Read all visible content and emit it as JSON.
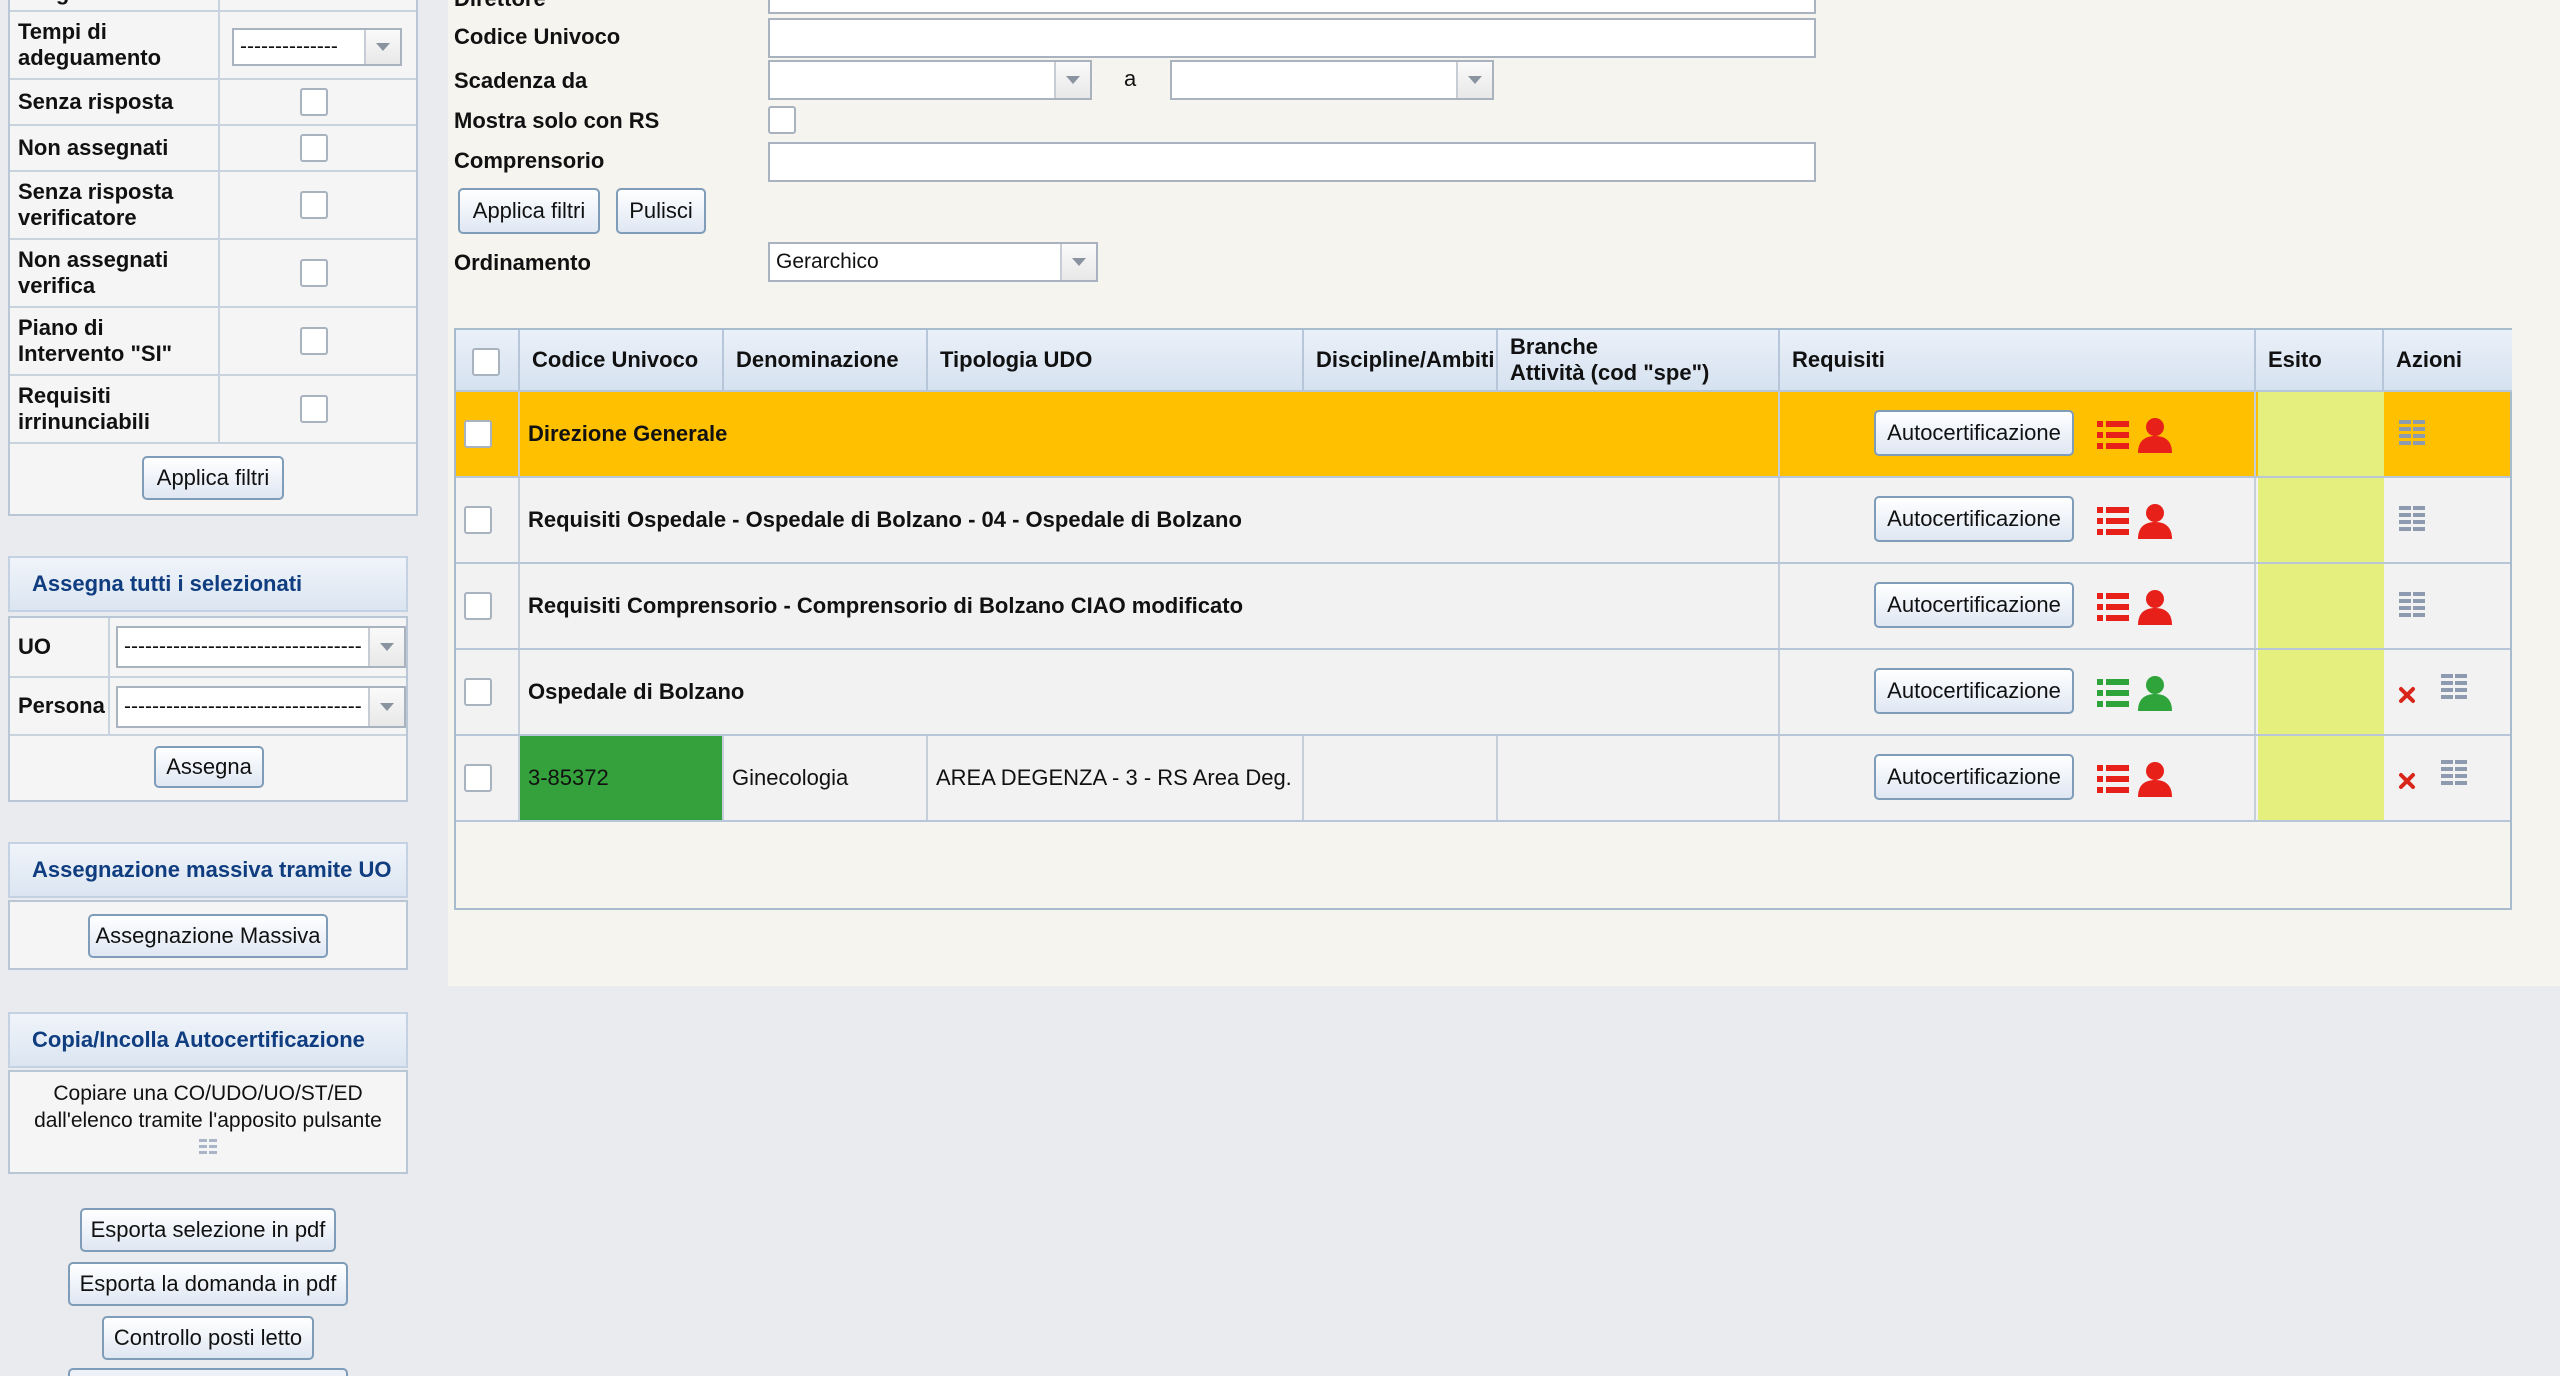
{
  "filters_left": {
    "rows": [
      {
        "label": "adeguamento",
        "type": "partial"
      },
      {
        "label": "Tempi di adeguamento",
        "type": "select",
        "value": "--------------"
      },
      {
        "label": "Senza risposta",
        "type": "checkbox"
      },
      {
        "label": "Non assegnati",
        "type": "checkbox"
      },
      {
        "label": "Senza risposta verificatore",
        "type": "checkbox"
      },
      {
        "label": "Non assegnati verifica",
        "type": "checkbox"
      },
      {
        "label": "Piano di Intervento \"SI\"",
        "type": "checkbox"
      },
      {
        "label": "Requisiti irrinunciabili",
        "type": "checkbox"
      }
    ],
    "apply_label": "Applica filtri"
  },
  "assign_all": {
    "title": "Assegna tutti i selezionati",
    "uo_label": "UO",
    "uo_value": "----------------------------------",
    "persona_label": "Persona",
    "persona_value": "----------------------------------",
    "assign_label": "Assegna"
  },
  "mass_assign": {
    "title": "Assegnazione massiva tramite UO",
    "button_label": "Assegnazione Massiva"
  },
  "copy_paste": {
    "title": "Copia/Incolla Autocertificazione",
    "text_line1": "Copiare una CO/UDO/UO/ST/ED",
    "text_line2": "dall'elenco tramite l'apposito pulsante"
  },
  "export": {
    "pdf_selection": "Esporta selezione in pdf",
    "pdf_request": "Esporta la domanda in pdf",
    "beds_check": "Controllo posti letto"
  },
  "filters_main": {
    "direttore_label": "Direttore",
    "codice_label": "Codice Univoco",
    "scadenza_label": "Scadenza da",
    "scadenza_a": "a",
    "mostra_label": "Mostra solo con RS",
    "comprensorio_label": "Comprensorio",
    "apply_label": "Applica filtri",
    "clear_label": "Pulisci",
    "ordinamento_label": "Ordinamento",
    "ordinamento_value": "Gerarchico"
  },
  "grid": {
    "headers": {
      "codice": "Codice Univoco",
      "denominazione": "Denominazione",
      "tipologia": "Tipologia UDO",
      "discipline": "Discipline/Ambiti",
      "branche_1": "Branche",
      "branche_2": "Attività (cod \"spe\")",
      "requisiti": "Requisiti",
      "esito": "Esito",
      "azioni": "Azioni"
    },
    "autocert_label": "Autocertificazione",
    "rows": [
      {
        "title": "Direzione Generale",
        "status": "red",
        "highlight": true,
        "delete": false
      },
      {
        "title": "Requisiti Ospedale - Ospedale di Bolzano - 04 - Ospedale di Bolzano",
        "status": "red",
        "highlight": false,
        "delete": false
      },
      {
        "title": "Requisiti Comprensorio - Comprensorio di Bolzano CIAO modificato",
        "status": "red",
        "highlight": false,
        "delete": false
      },
      {
        "title": "Ospedale di Bolzano",
        "status": "green",
        "highlight": false,
        "delete": true
      },
      {
        "codice": "3-85372",
        "denominazione": "Ginecologia",
        "tipologia": "AREA DEGENZA - 3 - RS Area Deg.",
        "status": "red",
        "highlight": false,
        "delete": true
      }
    ]
  },
  "colors": {
    "highlight_row": "#ffc000",
    "esito": "#e4ef7d",
    "codice_green": "#35a13c",
    "status_red": "#e8201a",
    "status_green": "#2ea43a",
    "section_title": "#0f3d80"
  }
}
